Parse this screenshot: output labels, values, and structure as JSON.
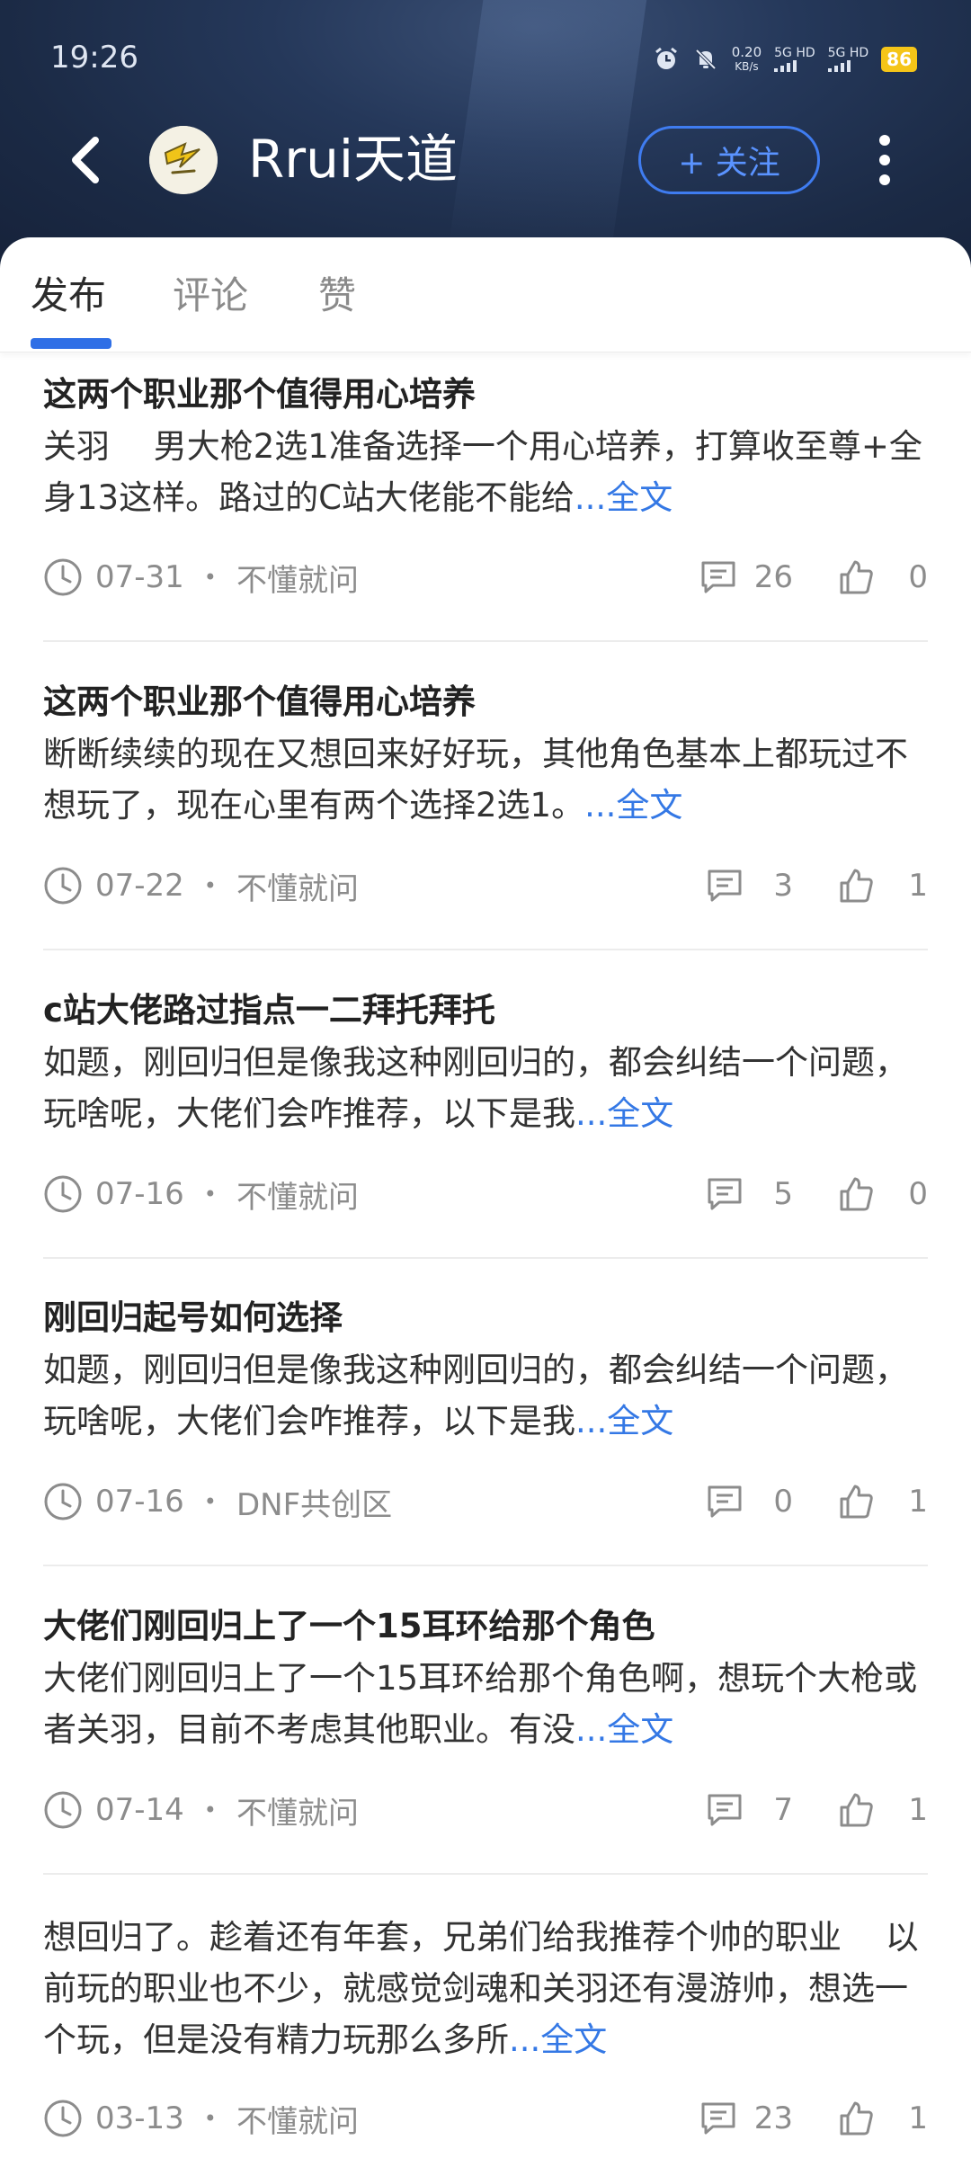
{
  "status_bar": {
    "time": "19:26",
    "net_speed": "0.20",
    "net_speed_unit": "KB/s",
    "sim1": "5G HD",
    "sim2": "5G HD",
    "battery": "86",
    "icons": [
      "alarm-icon",
      "mute-icon"
    ]
  },
  "profile": {
    "name": "Rrui天道",
    "follow_label": "+ 关注",
    "back_icon": "back-arrow-icon",
    "more_icon": "more-vertical-icon"
  },
  "tabs": [
    {
      "label": "发布",
      "active": true
    },
    {
      "label": "评论",
      "active": false
    },
    {
      "label": "赞",
      "active": false
    }
  ],
  "posts": [
    {
      "title": "这两个职业那个值得用心培养",
      "body": "关羽　 男大枪2选1准备选择一个用心培养，打算收至尊+全身13这样。路过的C站大佬能不能给",
      "more": "...全文",
      "date": "07-31",
      "category": "不懂就问",
      "comments": "26",
      "likes": "0"
    },
    {
      "title": "这两个职业那个值得用心培养",
      "body": "断断续续的现在又想回来好好玩，其他角色基本上都玩过不想玩了，现在心里有两个选择2选1。",
      "more": "...全文",
      "date": "07-22",
      "category": "不懂就问",
      "comments": "3",
      "likes": "1"
    },
    {
      "title": "c站大佬路过指点一二拜托拜托",
      "body": "如题，刚回归但是像我这种刚回归的，都会纠结一个问题，玩啥呢，大佬们会咋推荐，以下是我",
      "more": "...全文",
      "date": "07-16",
      "category": "不懂就问",
      "comments": "5",
      "likes": "0"
    },
    {
      "title": "刚回归起号如何选择",
      "body": "如题，刚回归但是像我这种刚回归的，都会纠结一个问题，玩啥呢，大佬们会咋推荐，以下是我",
      "more": "...全文",
      "date": "07-16",
      "category": "DNF共创区",
      "comments": "0",
      "likes": "1"
    },
    {
      "title": "大佬们刚回归上了一个15耳环给那个角色",
      "body": "大佬们刚回归上了一个15耳环给那个角色啊，想玩个大枪或者关羽，目前不考虑其他职业。有没",
      "more": "...全文",
      "date": "07-14",
      "category": "不懂就问",
      "comments": "7",
      "likes": "1"
    },
    {
      "title": "",
      "body": "想回归了。趁着还有年套，兄弟们给我推荐个帅的职业　 以前玩的职业也不少，就感觉剑魂和关羽还有漫游帅，想选一个玩，但是没有精力玩那么多所",
      "more": "...全文",
      "date": "03-13",
      "category": "不懂就问",
      "comments": "23",
      "likes": "1"
    }
  ]
}
